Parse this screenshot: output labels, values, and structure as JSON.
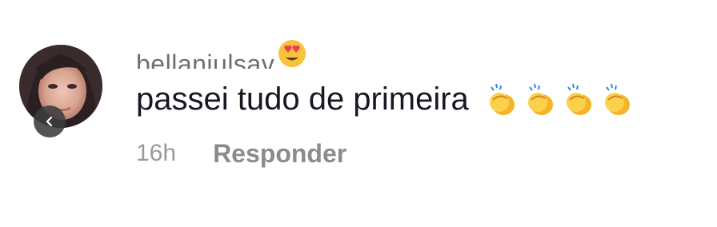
{
  "comment": {
    "username": "bellaniulsav",
    "username_emoji": "smiling-face-with-heart-eyes-emoji",
    "text": "passei tudo de primeira",
    "emojis": [
      "clapping-hands-emoji",
      "clapping-hands-emoji",
      "clapping-hands-emoji",
      "clapping-hands-emoji"
    ],
    "timestamp": "16h",
    "reply_label": "Responder"
  },
  "colors": {
    "username": "#6f6f6f",
    "text": "#161823",
    "meta": "#9a9a9a",
    "reply": "#8c8c8c",
    "back_button": "#3c3c3c"
  }
}
